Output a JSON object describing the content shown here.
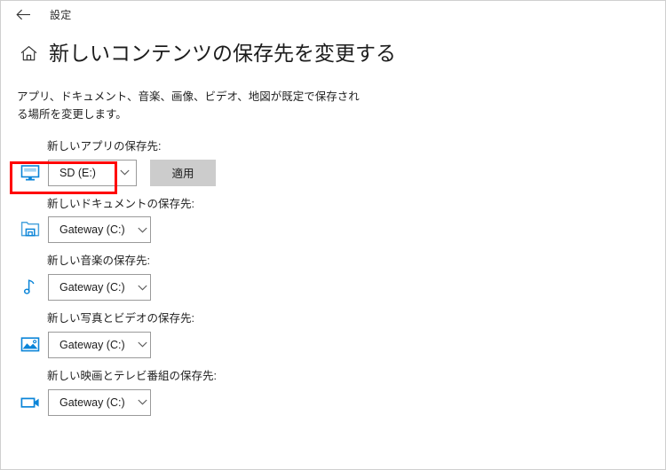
{
  "window": {
    "back_label": "back-arrow",
    "app_title": "設定"
  },
  "page": {
    "home_icon": "home-icon",
    "title": "新しいコンテンツの保存先を変更する",
    "description": "アプリ、ドキュメント、音楽、画像、ビデオ、地図が既定で保存される場所を変更します。"
  },
  "colors": {
    "accent": "#0078d7",
    "icon_blue": "#0a84d8",
    "highlight": "#ff0000",
    "button_bg": "#cccccc",
    "combo_border": "#9a9a9a"
  },
  "settings": [
    {
      "label": "新しいアプリの保存先:",
      "icon": "monitor-icon",
      "value": "SD (E:)",
      "chevron": "chevron-down-icon",
      "has_apply": true,
      "apply_label": "適用",
      "highlighted": true
    },
    {
      "label": "新しいドキュメントの保存先:",
      "icon": "documents-folder-icon",
      "value": "Gateway (C:)",
      "chevron": "chevron-down-icon",
      "has_apply": false,
      "highlighted": false
    },
    {
      "label": "新しい音楽の保存先:",
      "icon": "music-note-icon",
      "value": "Gateway (C:)",
      "chevron": "chevron-down-icon",
      "has_apply": false,
      "highlighted": false
    },
    {
      "label": "新しい写真とビデオの保存先:",
      "icon": "picture-icon",
      "value": "Gateway (C:)",
      "chevron": "chevron-down-icon",
      "has_apply": false,
      "highlighted": false
    },
    {
      "label": "新しい映画とテレビ番組の保存先:",
      "icon": "video-camera-icon",
      "value": "Gateway (C:)",
      "chevron": "chevron-down-icon",
      "has_apply": false,
      "highlighted": false
    }
  ]
}
